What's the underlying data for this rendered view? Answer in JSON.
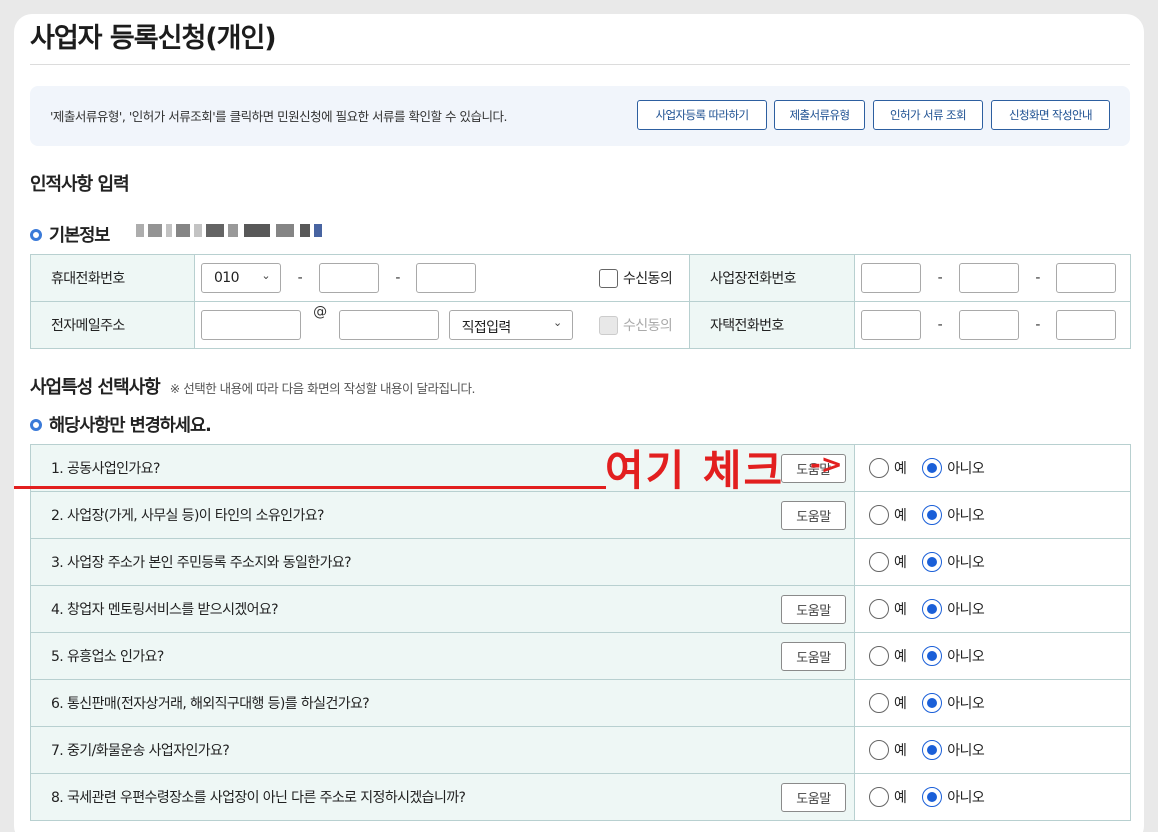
{
  "page_title": "사업자 등록신청(개인)",
  "info": {
    "text": "'제출서류유형', '인허가 서류조회'를 클릭하면 민원신청에 필요한 서류를 확인할 수 있습니다.",
    "buttons": [
      "사업자등록 따라하기",
      "제출서류유형",
      "인허가 서류 조회",
      "신청화면 작성안내"
    ]
  },
  "section1_title": "인적사항 입력",
  "basic_info": {
    "title": "기본정보",
    "mobile_label": "휴대전화번호",
    "mobile_prefix": "010",
    "email_label": "전자메일주소",
    "email_at": "@",
    "email_domain": "직접입력",
    "consent_label": "수신동의",
    "business_phone_label": "사업장전화번호",
    "home_phone_label": "자택전화번호",
    "dash": "-"
  },
  "section2": {
    "title": "사업특성 선택사항",
    "note": "※ 선택한 내용에 따라 다음 화면의 작성할 내용이 달라집니다.",
    "subtitle": "해당사항만 변경하세요."
  },
  "options": {
    "yes": "예",
    "no": "아니오",
    "help": "도움말"
  },
  "questions": [
    {
      "text": "1. 공동사업인가요?",
      "help": true,
      "selected": "no"
    },
    {
      "text": "2. 사업장(가게, 사무실 등)이 타인의 소유인가요?",
      "help": true,
      "selected": "no"
    },
    {
      "text": "3. 사업장 주소가 본인 주민등록 주소지와 동일한가요?",
      "help": false,
      "selected": "no"
    },
    {
      "text": "4. 창업자 멘토링서비스를 받으시겠어요?",
      "help": true,
      "selected": "no"
    },
    {
      "text": "5. 유흥업소 인가요?",
      "help": true,
      "selected": "no"
    },
    {
      "text": "6. 통신판매(전자상거래, 해외직구대행 등)를 하실건가요?",
      "help": false,
      "selected": "no"
    },
    {
      "text": "7. 중기/화물운송 사업자인가요?",
      "help": false,
      "selected": "no"
    },
    {
      "text": "8. 국세관련 우편수령장소를 사업장이 아닌 다른 주소로 지정하시겠습니까?",
      "help": true,
      "selected": "no"
    }
  ],
  "annotation": {
    "text": "여기 체크",
    "arrow": "->"
  },
  "colors": {
    "accent": "#1a5fd8",
    "annotation": "#e21f1f",
    "label_bg": "#eef7f5",
    "border": "#b8d0d0"
  }
}
